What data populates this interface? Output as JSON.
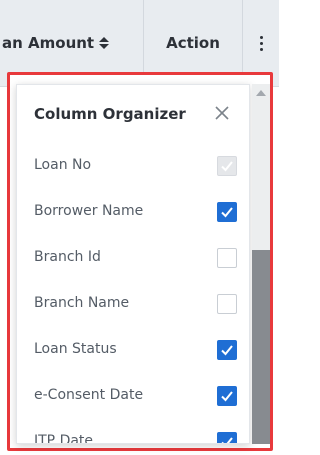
{
  "table_header": {
    "loan_amount_label": "an Amount",
    "action_label": "Action"
  },
  "column_organizer": {
    "title": "Column Organizer",
    "items": [
      {
        "label": "Loan No",
        "state": "disabled-checked"
      },
      {
        "label": "Borrower Name",
        "state": "checked"
      },
      {
        "label": "Branch Id",
        "state": "unchecked"
      },
      {
        "label": "Branch Name",
        "state": "unchecked"
      },
      {
        "label": "Loan Status",
        "state": "checked"
      },
      {
        "label": "e-Consent Date",
        "state": "checked"
      },
      {
        "label": "ITP Date",
        "state": "checked"
      }
    ]
  },
  "icons": {
    "sort": "sort-icon",
    "menu": "kebab-menu-icon",
    "close": "close-icon",
    "check": "check-icon"
  },
  "colors": {
    "checkbox_checked": "#1f6ed4",
    "highlight_border": "#e8393c",
    "header_bg": "#e8ecf0",
    "scroll_thumb": "#878b90"
  }
}
